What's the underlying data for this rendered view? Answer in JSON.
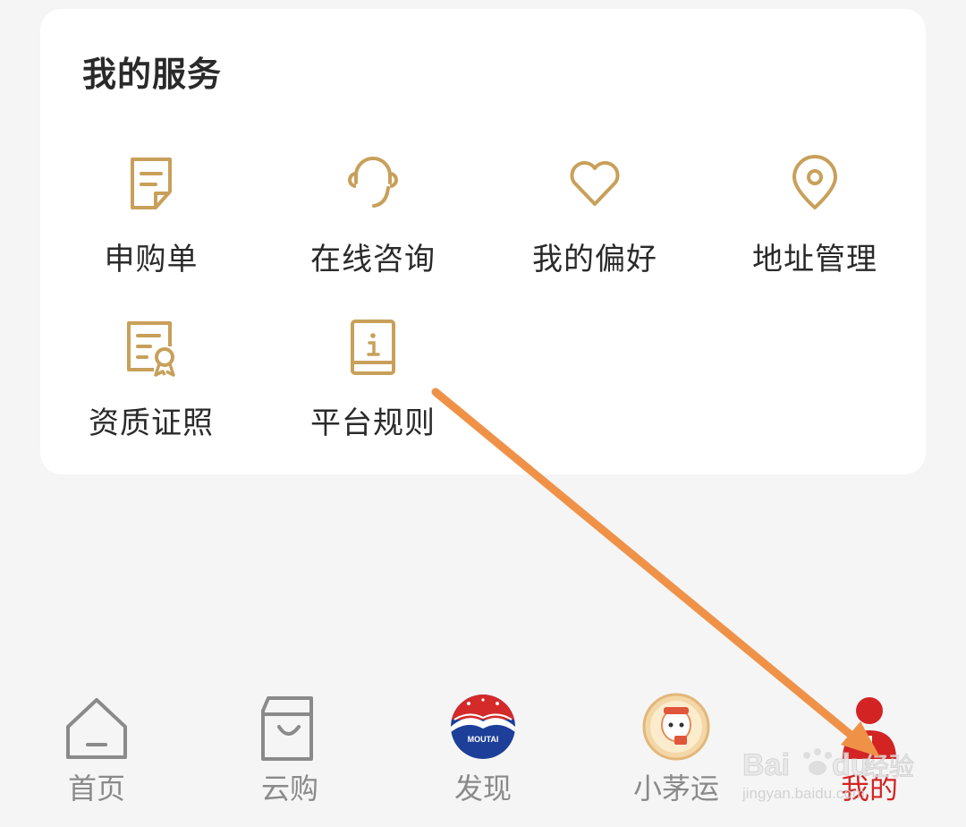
{
  "services": {
    "title": "我的服务",
    "items": [
      {
        "label": "申购单",
        "icon": "document-list-icon"
      },
      {
        "label": "在线咨询",
        "icon": "headset-icon"
      },
      {
        "label": "我的偏好",
        "icon": "heart-icon"
      },
      {
        "label": "地址管理",
        "icon": "location-pin-icon"
      },
      {
        "label": "资质证照",
        "icon": "certificate-icon"
      },
      {
        "label": "平台规则",
        "icon": "info-book-icon"
      }
    ]
  },
  "tabbar": {
    "items": [
      {
        "label": "首页",
        "icon": "home-icon"
      },
      {
        "label": "云购",
        "icon": "shopping-bag-icon"
      },
      {
        "label": "发现",
        "icon": "moutai-logo-icon",
        "badge_text": "MOUTAI"
      },
      {
        "label": "小茅运",
        "icon": "mascot-avatar-icon"
      },
      {
        "label": "我的",
        "icon": "user-icon",
        "active": true
      }
    ]
  },
  "watermark": {
    "brand": "Baidu经验",
    "url": "jingyan.baidu.com"
  },
  "colors": {
    "accent_gold": "#c8a05a",
    "active_red": "#d42323",
    "inactive_gray": "#8a8a8a",
    "annotation_arrow": "#ef9248",
    "background": "#f5f5f5",
    "card": "#ffffff"
  }
}
